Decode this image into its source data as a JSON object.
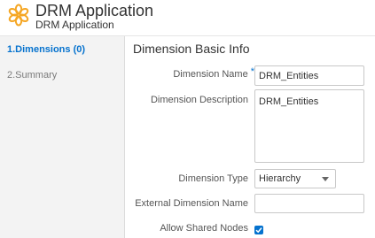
{
  "header": {
    "title": "DRM Application",
    "subtitle": "DRM Application",
    "logo_icon": "flower-logo-icon",
    "logo_color": "#f5a623"
  },
  "sidebar": {
    "steps": [
      {
        "label": "1.Dimensions (0)",
        "active": true
      },
      {
        "label": "2.Summary",
        "active": false
      }
    ],
    "active_color": "#0572ce"
  },
  "main": {
    "section_title": "Dimension Basic Info",
    "fields": {
      "dimension_name": {
        "label": "Dimension Name",
        "required": "*",
        "value": "DRM_Entities"
      },
      "dimension_description": {
        "label": "Dimension Description",
        "value": "DRM_Entities"
      },
      "dimension_type": {
        "label": "Dimension Type",
        "value": "Hierarchy"
      },
      "external_dimension_name": {
        "label": "External Dimension Name",
        "value": ""
      },
      "allow_shared_nodes": {
        "label": "Allow Shared Nodes",
        "checked": true
      }
    }
  }
}
